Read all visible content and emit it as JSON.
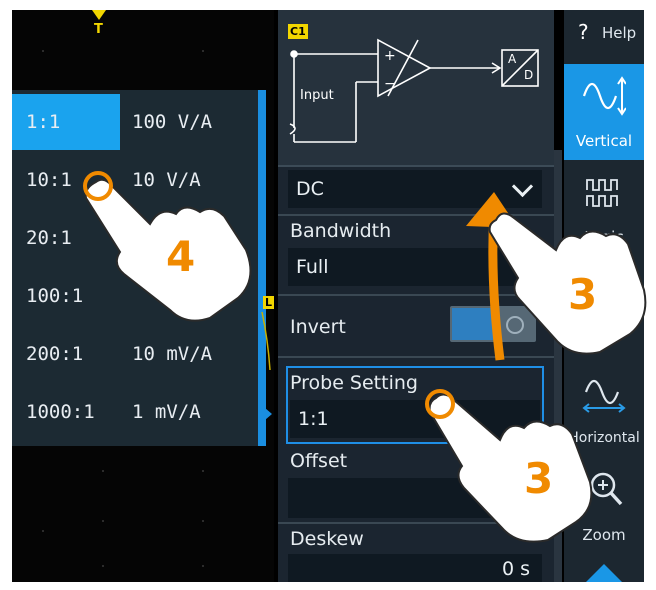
{
  "scope": {
    "trigger_label": "T",
    "channel_label": "L"
  },
  "probe_list": {
    "items": [
      {
        "ratio": "1:1",
        "value": "100 V/A",
        "selected": true
      },
      {
        "ratio": "10:1",
        "value": "10 V/A",
        "selected": false
      },
      {
        "ratio": "20:1",
        "value": "",
        "selected": false
      },
      {
        "ratio": "100:1",
        "value": "",
        "selected": false
      },
      {
        "ratio": "200:1",
        "value": "10 mV/A",
        "selected": false
      },
      {
        "ratio": "1000:1",
        "value": "1 mV/A",
        "selected": false
      }
    ]
  },
  "settings": {
    "channel_tag": "C1",
    "input_label": "Input",
    "adc_label_a": "A",
    "adc_label_d": "D",
    "coupling_value": "DC",
    "bandwidth_label": "Bandwidth",
    "bandwidth_value": "Full",
    "invert_label": "Invert",
    "probe_setting_label": "Probe Setting",
    "probe_setting_value": "1:1",
    "offset_label": "Offset",
    "offset_value": "",
    "deskew_label": "Deskew",
    "deskew_value": "0 s"
  },
  "sidebar": {
    "help_label": "Help",
    "vertical_label": "Vertical",
    "logic_label": "Logic",
    "horizontal_label": "Horizontal",
    "zoom_label": "Zoom"
  },
  "annotations": {
    "step_4": "4",
    "step_3a": "3",
    "step_3b": "3"
  },
  "colors": {
    "accent_blue": "#1a97e6",
    "highlight_orange": "#f08a00",
    "channel_yellow": "#f2d600"
  }
}
